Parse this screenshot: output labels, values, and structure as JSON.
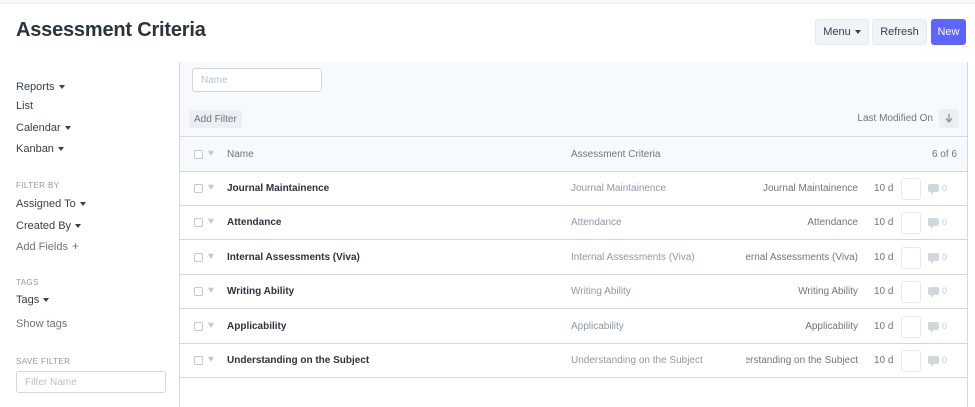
{
  "header": {
    "title": "Assessment Criteria",
    "menu_label": "Menu",
    "refresh_label": "Refresh",
    "new_label": "New"
  },
  "colors": {
    "primary": "#5e64ff",
    "border": "#d1d8dd",
    "muted_text": "#8d99a6"
  },
  "sidebar": {
    "reports": "Reports",
    "list": "List",
    "calendar": "Calendar",
    "kanban": "Kanban",
    "filter_by_heading": "FILTER BY",
    "assigned_to": "Assigned To",
    "created_by": "Created By",
    "add_fields": "Add Fields",
    "tags_heading": "TAGS",
    "tags": "Tags",
    "show_tags": "Show tags",
    "save_filter_heading": "SAVE FILTER",
    "filter_name_placeholder": "Filter Name"
  },
  "list": {
    "name_filter_placeholder": "Name",
    "add_filter_label": "Add Filter",
    "sort_label": "Last Modified On",
    "sort_icon": "arrow-down-icon",
    "columns": {
      "name": "Name",
      "criteria": "Assessment Criteria",
      "count": "6 of 6"
    },
    "rows": [
      {
        "name": "Journal Maintainence",
        "criteria": "Journal Maintainence",
        "right": "Journal Maintainence",
        "modified": "10 d",
        "comments": "0"
      },
      {
        "name": "Attendance",
        "criteria": "Attendance",
        "right": "Attendance",
        "modified": "10 d",
        "comments": "0"
      },
      {
        "name": "Internal Assessments (Viva)",
        "criteria": "Internal Assessments (Viva)",
        "right": "Internal Assessments (Viva)",
        "modified": "10 d",
        "comments": "0"
      },
      {
        "name": "Writing Ability",
        "criteria": "Writing Ability",
        "right": "Writing Ability",
        "modified": "10 d",
        "comments": "0"
      },
      {
        "name": "Applicability",
        "criteria": "Applicability",
        "right": "Applicability",
        "modified": "10 d",
        "comments": "0"
      },
      {
        "name": "Understanding on the Subject",
        "criteria": "Understanding on the Subject",
        "right": "Understanding on the Subject",
        "modified": "10 d",
        "comments": "0"
      }
    ]
  }
}
